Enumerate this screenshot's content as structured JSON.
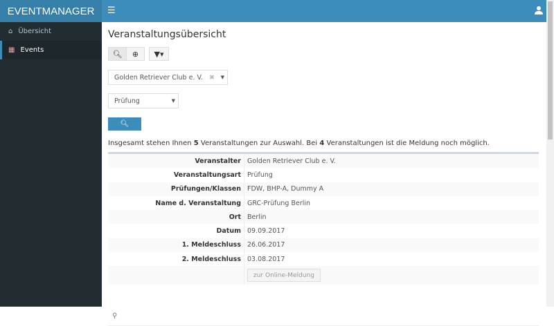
{
  "app": {
    "title": "EVENTMANAGER"
  },
  "header": {
    "menu_icon": "bars-icon",
    "user_icon": "user-icon"
  },
  "sidebar": {
    "items": [
      {
        "label": "Übersicht",
        "icon": "home-icon"
      },
      {
        "label": "Events",
        "icon": "calendar-icon",
        "active": true
      }
    ]
  },
  "main": {
    "title": "Veranstaltungsübersicht",
    "organizer_select": {
      "value": "Golden Retriever Club e. V."
    },
    "type_select": {
      "value": "Prüfung"
    },
    "summary": {
      "prefix": "Insgesamt stehen Ihnen ",
      "count": "5",
      "middle": " Veranstaltungen zur Auswahl. Bei ",
      "open": "4",
      "suffix": " Veranstaltungen ist die Meldung noch möglich."
    },
    "event": {
      "rows": [
        {
          "label": "Veranstalter",
          "value": "Golden Retriever Club e. V."
        },
        {
          "label": "Veranstaltungsart",
          "value": "Prüfung"
        },
        {
          "label": "Prüfungen/Klassen",
          "value": "FDW, BHP-A, Dummy A"
        },
        {
          "label": "Name d. Veranstaltung",
          "value": "GRC-Prüfung Berlin"
        },
        {
          "label": "Ort",
          "value": "Berlin"
        },
        {
          "label": "Datum",
          "value": "09.09.2017"
        },
        {
          "label": "1. Meldeschluss",
          "value": "26.06.2017"
        },
        {
          "label": "2. Meldeschluss",
          "value": "03.08.2017"
        }
      ],
      "register_label": "zur Online-Meldung"
    }
  },
  "colors": {
    "header": "#3c8dbc",
    "logo": "#367fa9",
    "sidebar": "#222d32"
  }
}
